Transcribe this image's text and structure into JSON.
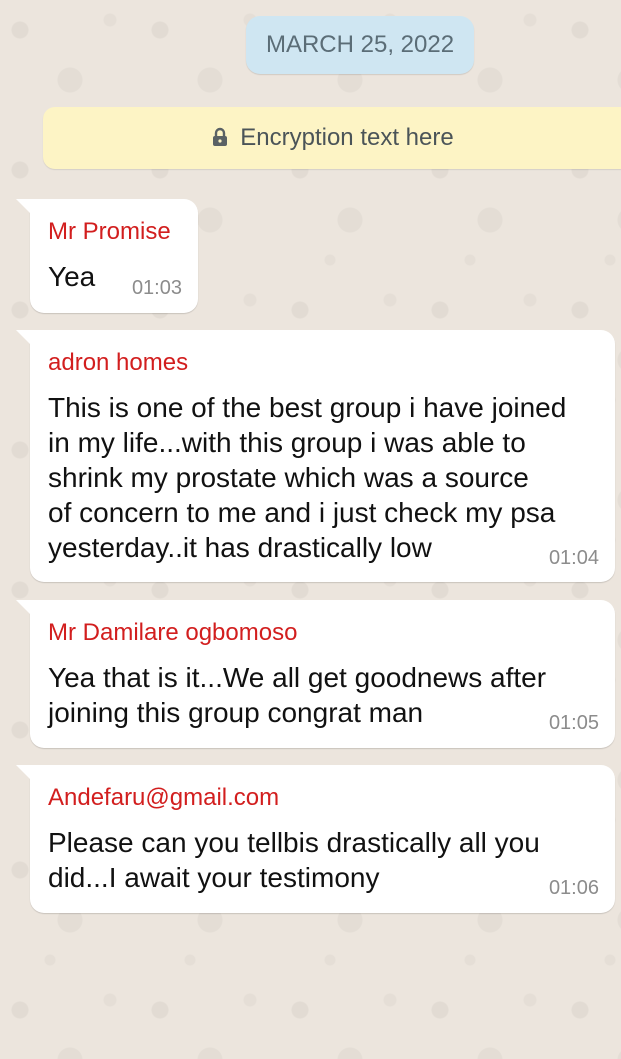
{
  "date_chip": "MARCH 25, 2022",
  "encryption_notice": "Encryption text here",
  "messages": [
    {
      "sender": "Mr Promise",
      "lines": [
        "Yea"
      ],
      "time": "01:03"
    },
    {
      "sender": "adron homes",
      "lines": [
        "This is one of the best group i have joined",
        "in my life...with this group i was able to",
        "shrink my prostate which was a source",
        "of concern to me and i just check my psa",
        "yesterday..it has drastically low"
      ],
      "time": "01:04"
    },
    {
      "sender": "Mr Damilare ogbomoso",
      "lines": [
        "Yea that is it...We all get goodnews after",
        "joining this group congrat man"
      ],
      "time": "01:05"
    },
    {
      "sender": "Andefaru@gmail.com",
      "lines": [
        "Please can you tellbis drastically all you",
        "did...I await your testimony"
      ],
      "time": "01:06"
    }
  ],
  "colors": {
    "sender_name": "#d21e1e",
    "date_chip_bg": "#cfe6f2",
    "encryption_bg": "#fdf4c5",
    "chat_bg": "#ece5dd"
  },
  "icons": {
    "encryption": "lock-icon"
  }
}
